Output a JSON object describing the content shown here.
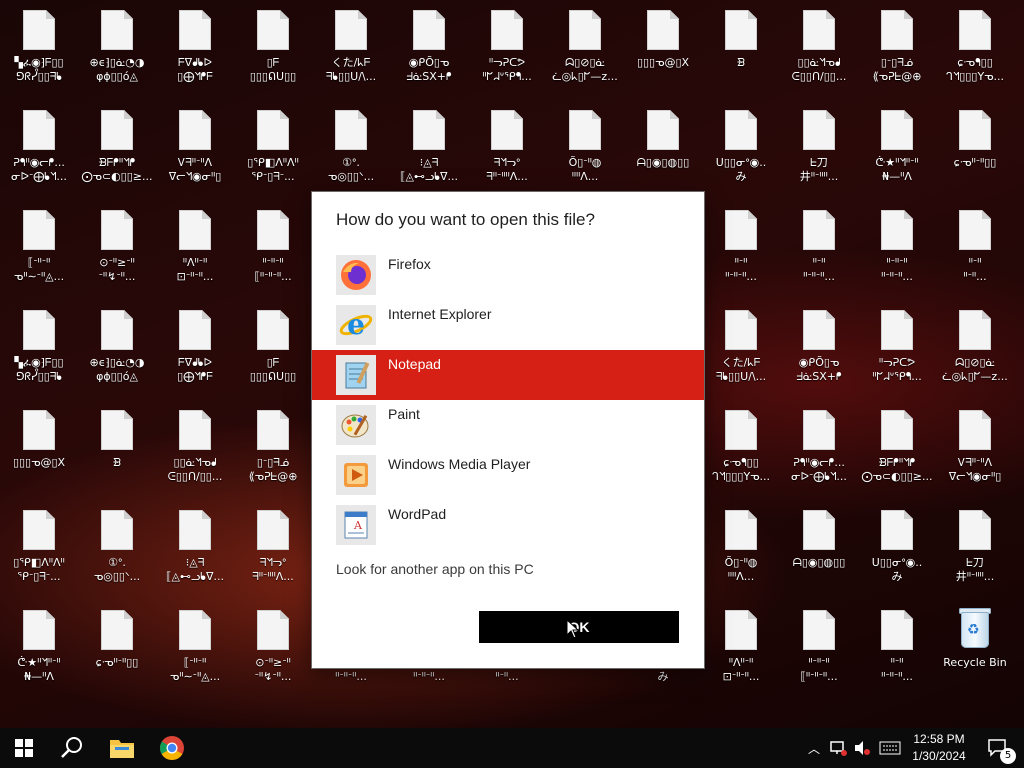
{
  "desktop": {
    "icons": [
      {
        "label": "▚ፈ◉⁆ᖴ▯▯\n⅁ᖇᓮ▯▯ᖷᖲ"
      },
      {
        "label": "⊕ϵ⁆▯ᓎ◔◑\nφϕ▯▯ό◬"
      },
      {
        "label": "ᖴᐁᖱᖲᐅ\n▯⨁ᖿᖰᖴ"
      },
      {
        "label": "▯ᖴ\n▯▯▯ᕠᑌ▯▯"
      },
      {
        "label": "くた/ᖾᖴ\nᖷᖲ▯▯U/\\..."
      },
      {
        "label": "◉ᑭÕ▯ᓀ\nᖵᓎSX+ᖰ"
      },
      {
        "label": "ᐦᓓᕈᑕᕗ\nᐦᖸᖹᐡᕿᖳ..."
      },
      {
        "label": "ᗣ▯⊘▯ᓎ\nᓛ◎ᖾ▯ᖸ—z..."
      },
      {
        "label": "▯▯▯ᓀ@▯X\n"
      },
      {
        "label": "ᗿ\n"
      },
      {
        "label": "▯▯ᓎᖿᓀᖱ\nᕮ▯▯ᑎ/▯▯..."
      },
      {
        "label": "▯ᐨ▯ᖷᓅ\n⟪ᓀᕈᖶ@⊕"
      },
      {
        "label": "ɕᓉᖳ▯▯\nᒉᖿ▯▯▯Yᓀ..."
      },
      {
        "label": "ᕈᖳᐦ◉ᓕᖰ...\nᓂᐅᐨ⨁ᖲᖿ..."
      },
      {
        "label": "ᗿᖴᖰᐦᖿᖰ\n⨀ᓀ⊂◐▯▯≥..."
      },
      {
        "label": "Ꮩᖷᐦᐨᐦᐱ\nᐁᓕᖿ◉ᓂᐦ▯"
      },
      {
        "label": "▯ᕿ◧ᐱᐦᐱᐦ\nᕿᐨ▯ᖷᐨ..."
      },
      {
        "label": "①ᐤ.\nᓀ◎▯▯ᐠ..."
      },
      {
        "label": "⁝◬ᖷ\n⟦◬⊷ᓗᖲᐁ..."
      },
      {
        "label": "ᖷᖿᓓᐤ\nᖷᐦᐨᐦᐦᐱ..."
      },
      {
        "label": "Õ▯ᐨᐦ◍\nᐦᐦᐱ..."
      },
      {
        "label": "ᗩ▯◉▯◍▯▯\n"
      },
      {
        "label": "U▯▯ᓂᐤ◉..\nみ"
      },
      {
        "label": "ᖶ刀\n井ᐦᐨᐦᐦ..."
      },
      {
        "label": "ᕩ★ᐦᖿᐦᐨᐦ\n₦—ᐦᐱ"
      },
      {
        "label": "ɕᓉᐦᐨᐦ▯▯\n"
      },
      {
        "label": "⟦ᐨᐦᐨᐦ\nᓀᐦ∼ᐨᐦ◬..."
      },
      {
        "label": "⊙ᐨᐦ≥ᐨᐦ\nᐨᐦ↯ᐨᐦ..."
      },
      {
        "label": "ᐦᐱᐦᐨᐦ\n⊡ᐨᐦᐨᐦ..."
      },
      {
        "label": "ᐦᐨᐦᐨᐦ\n⟦ᐦᐨᐦᐨᐦ..."
      },
      {
        "label": "ᐦᐨᐦ\nᐦᐨᐦᐨᐦ..."
      },
      {
        "label": "ᐦᐨᐦ\nᐦᐨᐦᐨᐦ..."
      },
      {
        "label": "ᐦᐨᐦᐨᐦ\nᐦᐨᐦᐨᐦ..."
      },
      {
        "label": "ᐦᐨᐦ\nᐦᐨᐦ..."
      },
      {
        "label": "Recycle Bin"
      }
    ]
  },
  "dialog": {
    "title": "How do you want to open this file?",
    "apps": [
      {
        "name": "Firefox",
        "icon": "firefox-icon",
        "selected": false
      },
      {
        "name": "Internet Explorer",
        "icon": "internet-explorer-icon",
        "selected": false
      },
      {
        "name": "Notepad",
        "icon": "notepad-icon",
        "selected": true
      },
      {
        "name": "Paint",
        "icon": "paint-icon",
        "selected": false
      },
      {
        "name": "Windows Media Player",
        "icon": "media-player-icon",
        "selected": false
      },
      {
        "name": "WordPad",
        "icon": "wordpad-icon",
        "selected": false
      }
    ],
    "look_link": "Look for another app on this PC",
    "ok_label": "OK",
    "accent": "#d62015"
  },
  "taskbar": {
    "clock_time": "12:58 PM",
    "clock_date": "1/30/2024",
    "notification_count": "5"
  }
}
